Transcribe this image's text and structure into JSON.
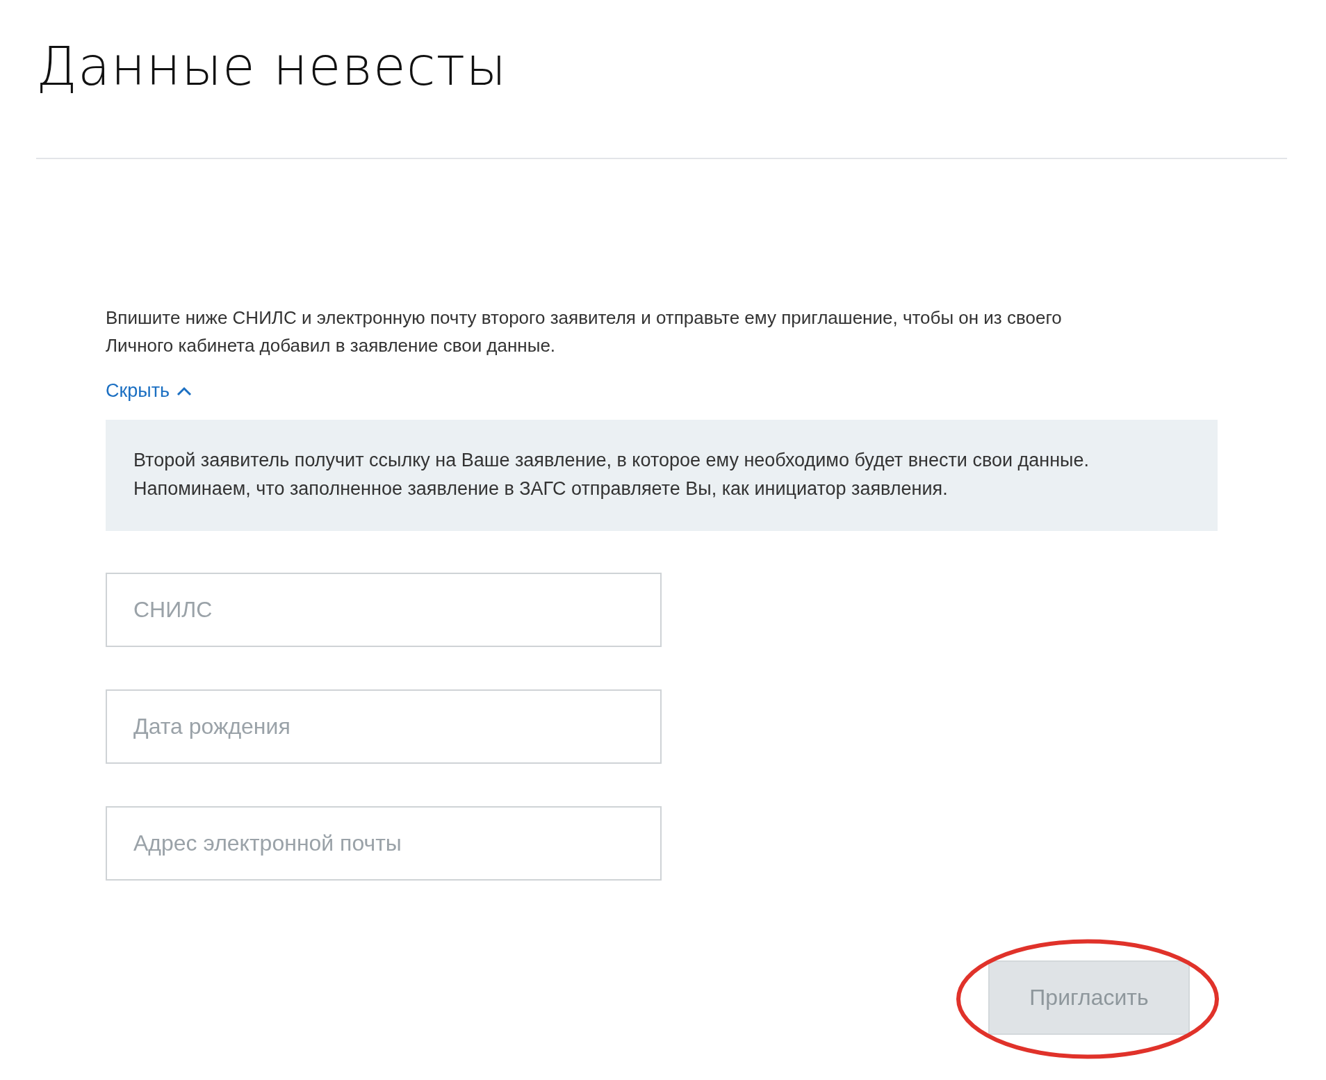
{
  "page": {
    "title": "Данные невесты"
  },
  "invite": {
    "description": "Впишите ниже СНИЛС и электронную почту второго заявителя и отправьте ему приглашение, чтобы он из своего Личного кабинета добавил в заявление свои данные.",
    "toggle": {
      "label": "Скрыть",
      "expanded": true
    },
    "info": "Второй заявитель получит ссылку на Ваше заявление, в которое ему необходимо будет внести свои данные. Напоминаем, что заполненное заявление в ЗАГС отправляете Вы, как инициатор заявления.",
    "fields": [
      {
        "placeholder": "СНИЛС"
      },
      {
        "placeholder": "Дата рождения"
      },
      {
        "placeholder": "Адрес электронной почты"
      }
    ],
    "button": {
      "label": "Пригласить",
      "disabled": true
    }
  }
}
